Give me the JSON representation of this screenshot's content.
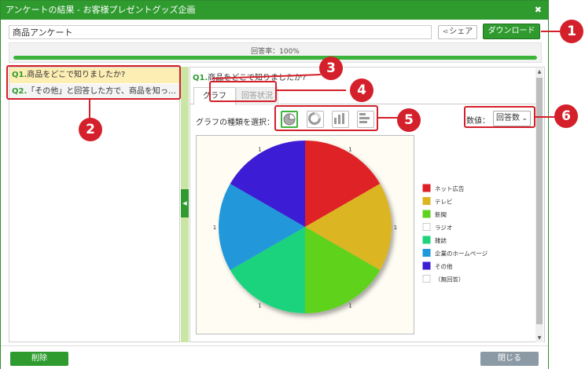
{
  "window": {
    "title": "アンケートの結果 - お客様プレゼントグッズ企画"
  },
  "header": {
    "survey_name": "商品アンケート",
    "share_label": "シェア",
    "download_label": "ダウンロード"
  },
  "response_rate": {
    "label": "回答率：100%",
    "value": 100
  },
  "questions": [
    {
      "num": "Q1.",
      "text": "商品をどこで知りましたか?"
    },
    {
      "num": "Q2.",
      "text": "「その他」と回答した方で、商品を知っ…"
    }
  ],
  "detail": {
    "q_num": "Q1.",
    "q_text": "商品をどこで知りましたか?",
    "tabs": [
      "グラフ",
      "回答状況"
    ],
    "chart_type_label": "グラフの種類を選択：",
    "chart_types": [
      "pie-chart-icon",
      "donut-chart-icon",
      "column-chart-icon",
      "bar-chart-icon"
    ],
    "value_label": "数値：",
    "value_option": "回答数"
  },
  "chart_data": {
    "type": "pie",
    "categories": [
      "ネット広告",
      "テレビ",
      "新聞",
      "ラジオ",
      "雑誌",
      "企業のホームページ",
      "その他",
      "（無回答）"
    ],
    "values": [
      1,
      1,
      1,
      0,
      1,
      1,
      1,
      0
    ],
    "data_labels": [
      "1",
      "1",
      "1",
      "1",
      "1",
      "1"
    ],
    "colors": [
      "#de2127",
      "#dcb522",
      "#5fd21f",
      "#ffffff",
      "#1fd37d",
      "#2098da",
      "#3c1fd5",
      "#ffffff"
    ],
    "legend": "right"
  },
  "footer": {
    "delete_label": "削除",
    "close_label": "閉じる"
  },
  "callouts": [
    "1",
    "2",
    "3",
    "4",
    "5",
    "6"
  ],
  "accent": "#2f9b2f",
  "callout_color": "#d4202a"
}
